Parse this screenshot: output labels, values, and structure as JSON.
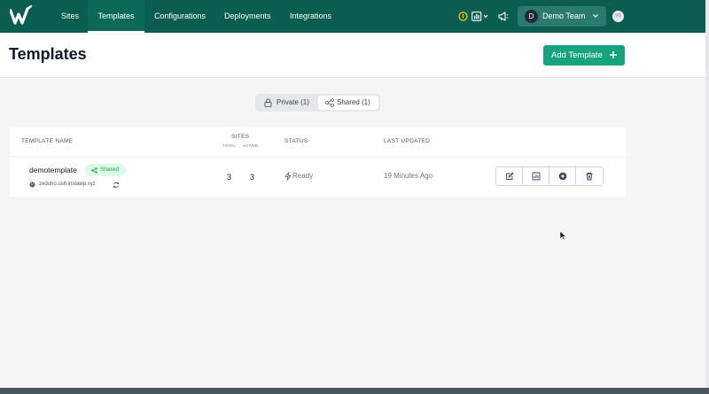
{
  "nav": {
    "items": [
      {
        "label": "Sites",
        "active": false
      },
      {
        "label": "Templates",
        "active": true
      },
      {
        "label": "Configurations",
        "active": false
      },
      {
        "label": "Deployments",
        "active": false
      },
      {
        "label": "Integrations",
        "active": false
      }
    ],
    "team": {
      "initial": "D",
      "name": "Demo Team"
    },
    "user_initials": "VS"
  },
  "page": {
    "title": "Templates",
    "add_button": "Add Template"
  },
  "tabs": {
    "private": "Private (1)",
    "shared": "Shared (1)",
    "selected": "shared"
  },
  "table": {
    "headers": {
      "name": "TEMPLATE NAME",
      "sites": "SITES",
      "total": "TOTAL",
      "active": "ACTIVE",
      "status": "STATUS",
      "updated": "LAST UPDATED"
    },
    "rows": [
      {
        "name": "demotemplate",
        "badge": "Shared",
        "domain": "zeduho.us6.instawp.xyz",
        "total": "3",
        "active": "3",
        "status": "Ready",
        "updated": "19 Minutes Ago"
      }
    ]
  },
  "colors": {
    "brand": "#0b5e4f",
    "accent": "#16a37e",
    "badge_text": "#16a34a"
  },
  "icons": [
    "info-icon",
    "chart-icon",
    "megaphone-icon",
    "lock-icon",
    "share-icon",
    "globe-icon",
    "refresh-icon",
    "bolt-icon",
    "edit-icon",
    "stats-icon",
    "add-circle-icon",
    "trash-icon"
  ]
}
